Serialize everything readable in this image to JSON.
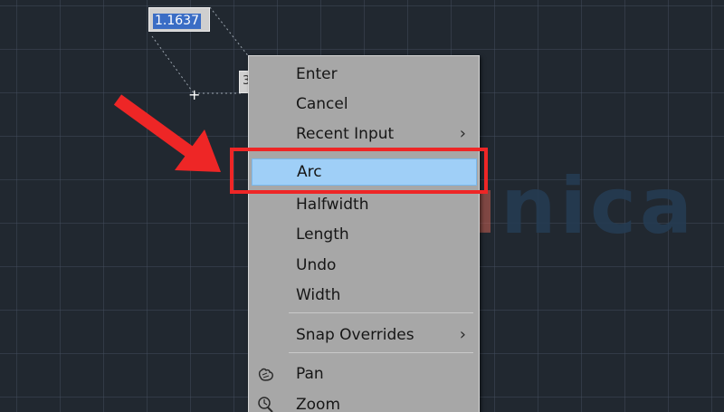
{
  "canvas": {
    "dynamic_input_value": "1.1637",
    "dynamic_input_partial": "3"
  },
  "watermark": {
    "first": "u",
    "rest": "nica"
  },
  "context_menu": {
    "items": [
      {
        "label": "Enter"
      },
      {
        "label": "Cancel"
      },
      {
        "label": "Recent Input",
        "submenu": true
      },
      {
        "label": "Arc",
        "highlighted": true
      },
      {
        "label": "Halfwidth"
      },
      {
        "label": "Length"
      },
      {
        "label": "Undo"
      },
      {
        "label": "Width"
      },
      {
        "label": "Snap Overrides",
        "submenu": true
      },
      {
        "label": "Pan",
        "icon": "pan-icon"
      },
      {
        "label": "Zoom",
        "icon": "zoom-icon"
      }
    ],
    "submenu_glyph": "›"
  },
  "colors": {
    "background": "#212830",
    "menu_bg": "#a7a7a7",
    "highlight": "#9fcff7",
    "annotation_red": "#ee2626"
  }
}
